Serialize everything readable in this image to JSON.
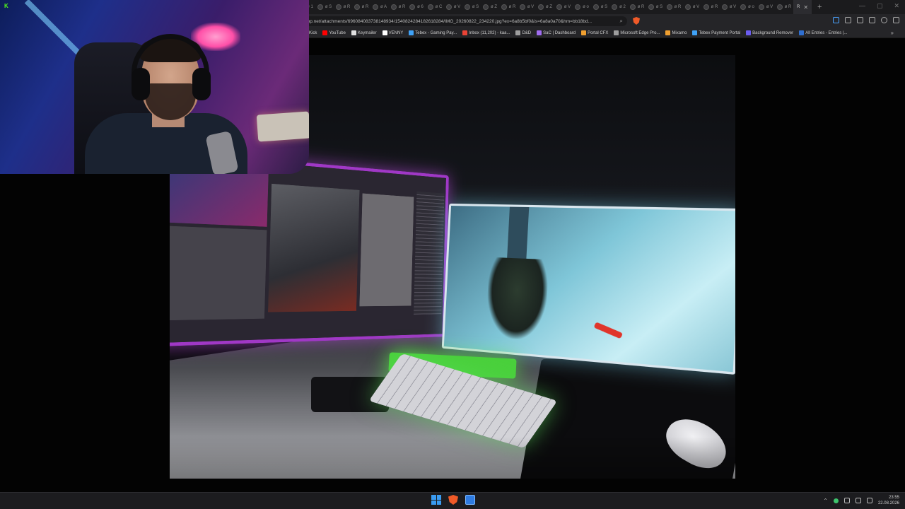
{
  "browser": {
    "url": "app.net/attachments/696084083738148934/1540824284182618284/IMG_20260822_234220.jpg?ex=6a8b5bf0&is=6a8a0a70&hm=bb18bd...",
    "tabs": [
      "ø 1",
      "ø S",
      "ø R",
      "ø R",
      "ø A",
      "ø R",
      "ø 6",
      "ø C",
      "ø V",
      "ø S",
      "ø Z",
      "ø R",
      "ø V",
      "ø Z",
      "ø V",
      "ø o",
      "ø S",
      "ø 2",
      "ø R",
      "ø S",
      "ø R",
      "ø V",
      "ø R",
      "ø V",
      "ø o",
      "ø V",
      "ø R"
    ],
    "active_tab": "R",
    "new_tab": "+",
    "bookmarks": [
      {
        "label": "Kick",
        "color": "#53fc18"
      },
      {
        "label": "YouTube",
        "color": "#ff0000"
      },
      {
        "label": "Keymailer",
        "color": "#e0e0e0"
      },
      {
        "label": "VENNY",
        "color": "#ffffff"
      },
      {
        "label": "Tebex - Gaming Pay...",
        "color": "#3fa2f7"
      },
      {
        "label": "Inbox (11,202) - kaa...",
        "color": "#ea4335"
      },
      {
        "label": "D&D",
        "color": "#9e9e9e"
      },
      {
        "label": "SaC | Dashboard",
        "color": "#a06cf0"
      },
      {
        "label": "Portal CFX",
        "color": "#f0a030"
      },
      {
        "label": "Microsoft Edge Pro...",
        "color": "#9e9e9e"
      },
      {
        "label": "Mixamo",
        "color": "#f0a030"
      },
      {
        "label": "Tebex Payment Portal",
        "color": "#3fa2f7"
      },
      {
        "label": "Background Remover",
        "color": "#6b5cf0"
      },
      {
        "label": "All Entries - Entries |...",
        "color": "#2f6fd0"
      }
    ],
    "accent": "#f05a28"
  },
  "overlay": {
    "platform_badge": "K"
  },
  "taskbar": {
    "time": "23:55",
    "date": "22.08.2026"
  }
}
